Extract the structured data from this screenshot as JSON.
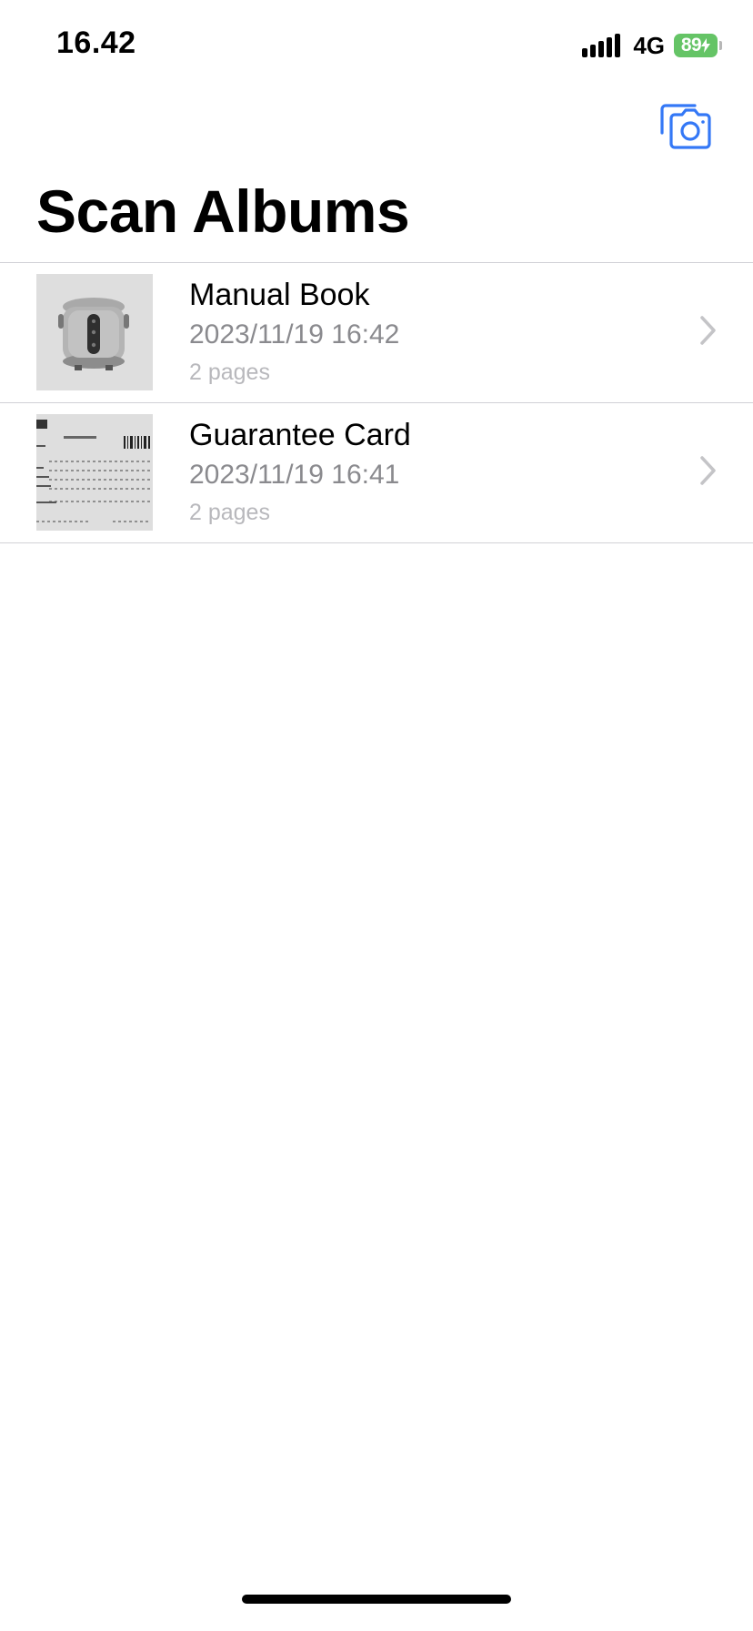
{
  "status_bar": {
    "time": "16.42",
    "network": "4G",
    "battery": "89"
  },
  "header": {
    "title": "Scan Albums",
    "camera_icon": "camera-icon"
  },
  "albums": [
    {
      "name": "Manual Book",
      "date": "2023/11/19 16:42",
      "pages": "2 pages",
      "thumbnail": "rice-cooker-photo"
    },
    {
      "name": "Guarantee Card",
      "date": "2023/11/19 16:41",
      "pages": "2 pages",
      "thumbnail": "guarantee-card-scan"
    }
  ],
  "colors": {
    "accent": "#3478f6",
    "battery": "#65c466",
    "secondary_text": "#8a8a8e",
    "tertiary_text": "#b8b8bc",
    "separator": "#d1d1d6"
  }
}
